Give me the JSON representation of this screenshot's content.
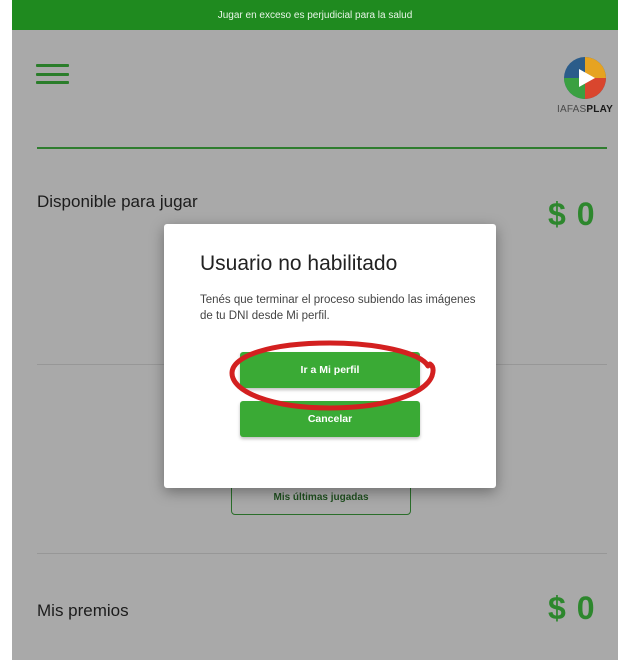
{
  "banner": {
    "text": "Jugar en exceso es perjudicial para la salud"
  },
  "logo": {
    "text_light": "IAFAS",
    "text_bold": "PLAY"
  },
  "balance": {
    "label": "Disponible para jugar",
    "amount": "$ 0"
  },
  "history": {
    "button_label": "Mis últimas jugadas"
  },
  "prizes": {
    "label": "Mis premios",
    "amount": "$ 0"
  },
  "modal": {
    "title": "Usuario no habilitado",
    "message": "Tenés que terminar el proceso subiendo las imágenes de tu DNI desde Mi perfil.",
    "primary_label": "Ir a Mi perfil",
    "secondary_label": "Cancelar"
  },
  "colors": {
    "brand_green": "#3aaa35",
    "banner_green": "#1f8a1f",
    "annotation_red": "#d32020"
  },
  "icons": {
    "menu": "hamburger-icon"
  }
}
